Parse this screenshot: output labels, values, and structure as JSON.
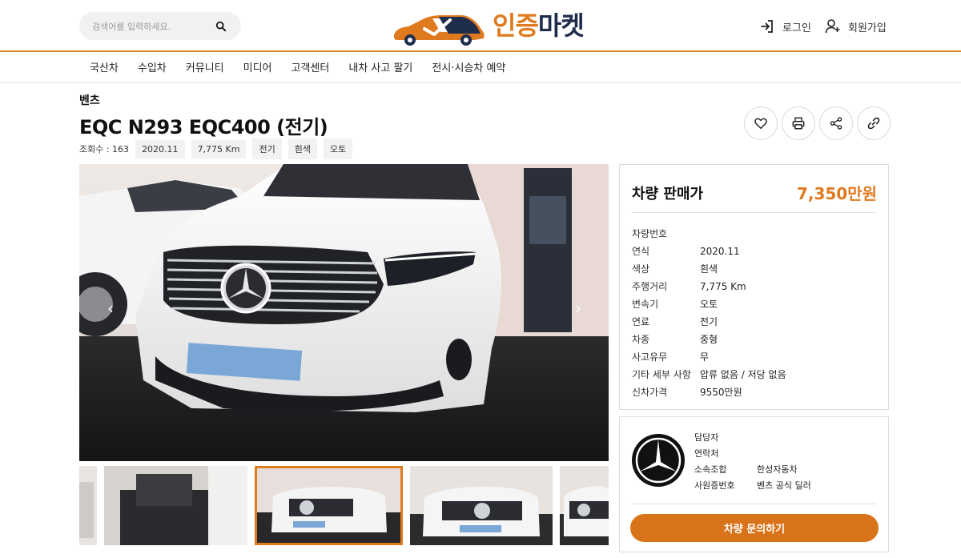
{
  "header": {
    "search_placeholder": "검색어를 입력하세요.",
    "logo_text_1": "인증",
    "logo_text_2": "마켓",
    "login_label": "로그인",
    "signup_label": "회원가입"
  },
  "nav": {
    "items": [
      "국산차",
      "수입차",
      "커뮤니티",
      "미디어",
      "고객센터",
      "내차 사고 팔기",
      "전시·시승차 예약"
    ]
  },
  "listing": {
    "brand": "벤츠",
    "title": "EQC N293 EQC400 (전기)",
    "views": "조회수 : 163",
    "chips": [
      "2020.11",
      "7,775 Km",
      "전기",
      "흰색",
      "오토"
    ]
  },
  "gallery": {
    "prev_icon": "‹",
    "next_icon": "›",
    "selected_index": 2
  },
  "price": {
    "label": "차량 판매가",
    "value": "7,350만원"
  },
  "specs": [
    {
      "k": "차량번호",
      "v": ""
    },
    {
      "k": "연식",
      "v": "2020.11"
    },
    {
      "k": "색상",
      "v": "흰색"
    },
    {
      "k": "주행거리",
      "v": "7,775 Km"
    },
    {
      "k": "변속기",
      "v": "오토"
    },
    {
      "k": "연료",
      "v": "전기"
    },
    {
      "k": "차종",
      "v": "중형"
    },
    {
      "k": "사고유무",
      "v": "무"
    },
    {
      "k": "기타 세부 사항",
      "v": "압류 없음 / 저당 없음"
    },
    {
      "k": "신차가격",
      "v": "9550만원"
    }
  ],
  "dealer": {
    "manager_label": "담당자",
    "manager_value": "",
    "contact_label": "연락처",
    "contact_value": "",
    "company_label": "소속조합",
    "company_value": "한성자동차",
    "employee_label": "사원증번호",
    "employee_value": "벤츠 공식 딜러",
    "cta_label": "차량 문의하기"
  },
  "colors": {
    "accent": "#e07a1f",
    "navy": "#1f2d4d",
    "header_rule": "#d28a23"
  }
}
